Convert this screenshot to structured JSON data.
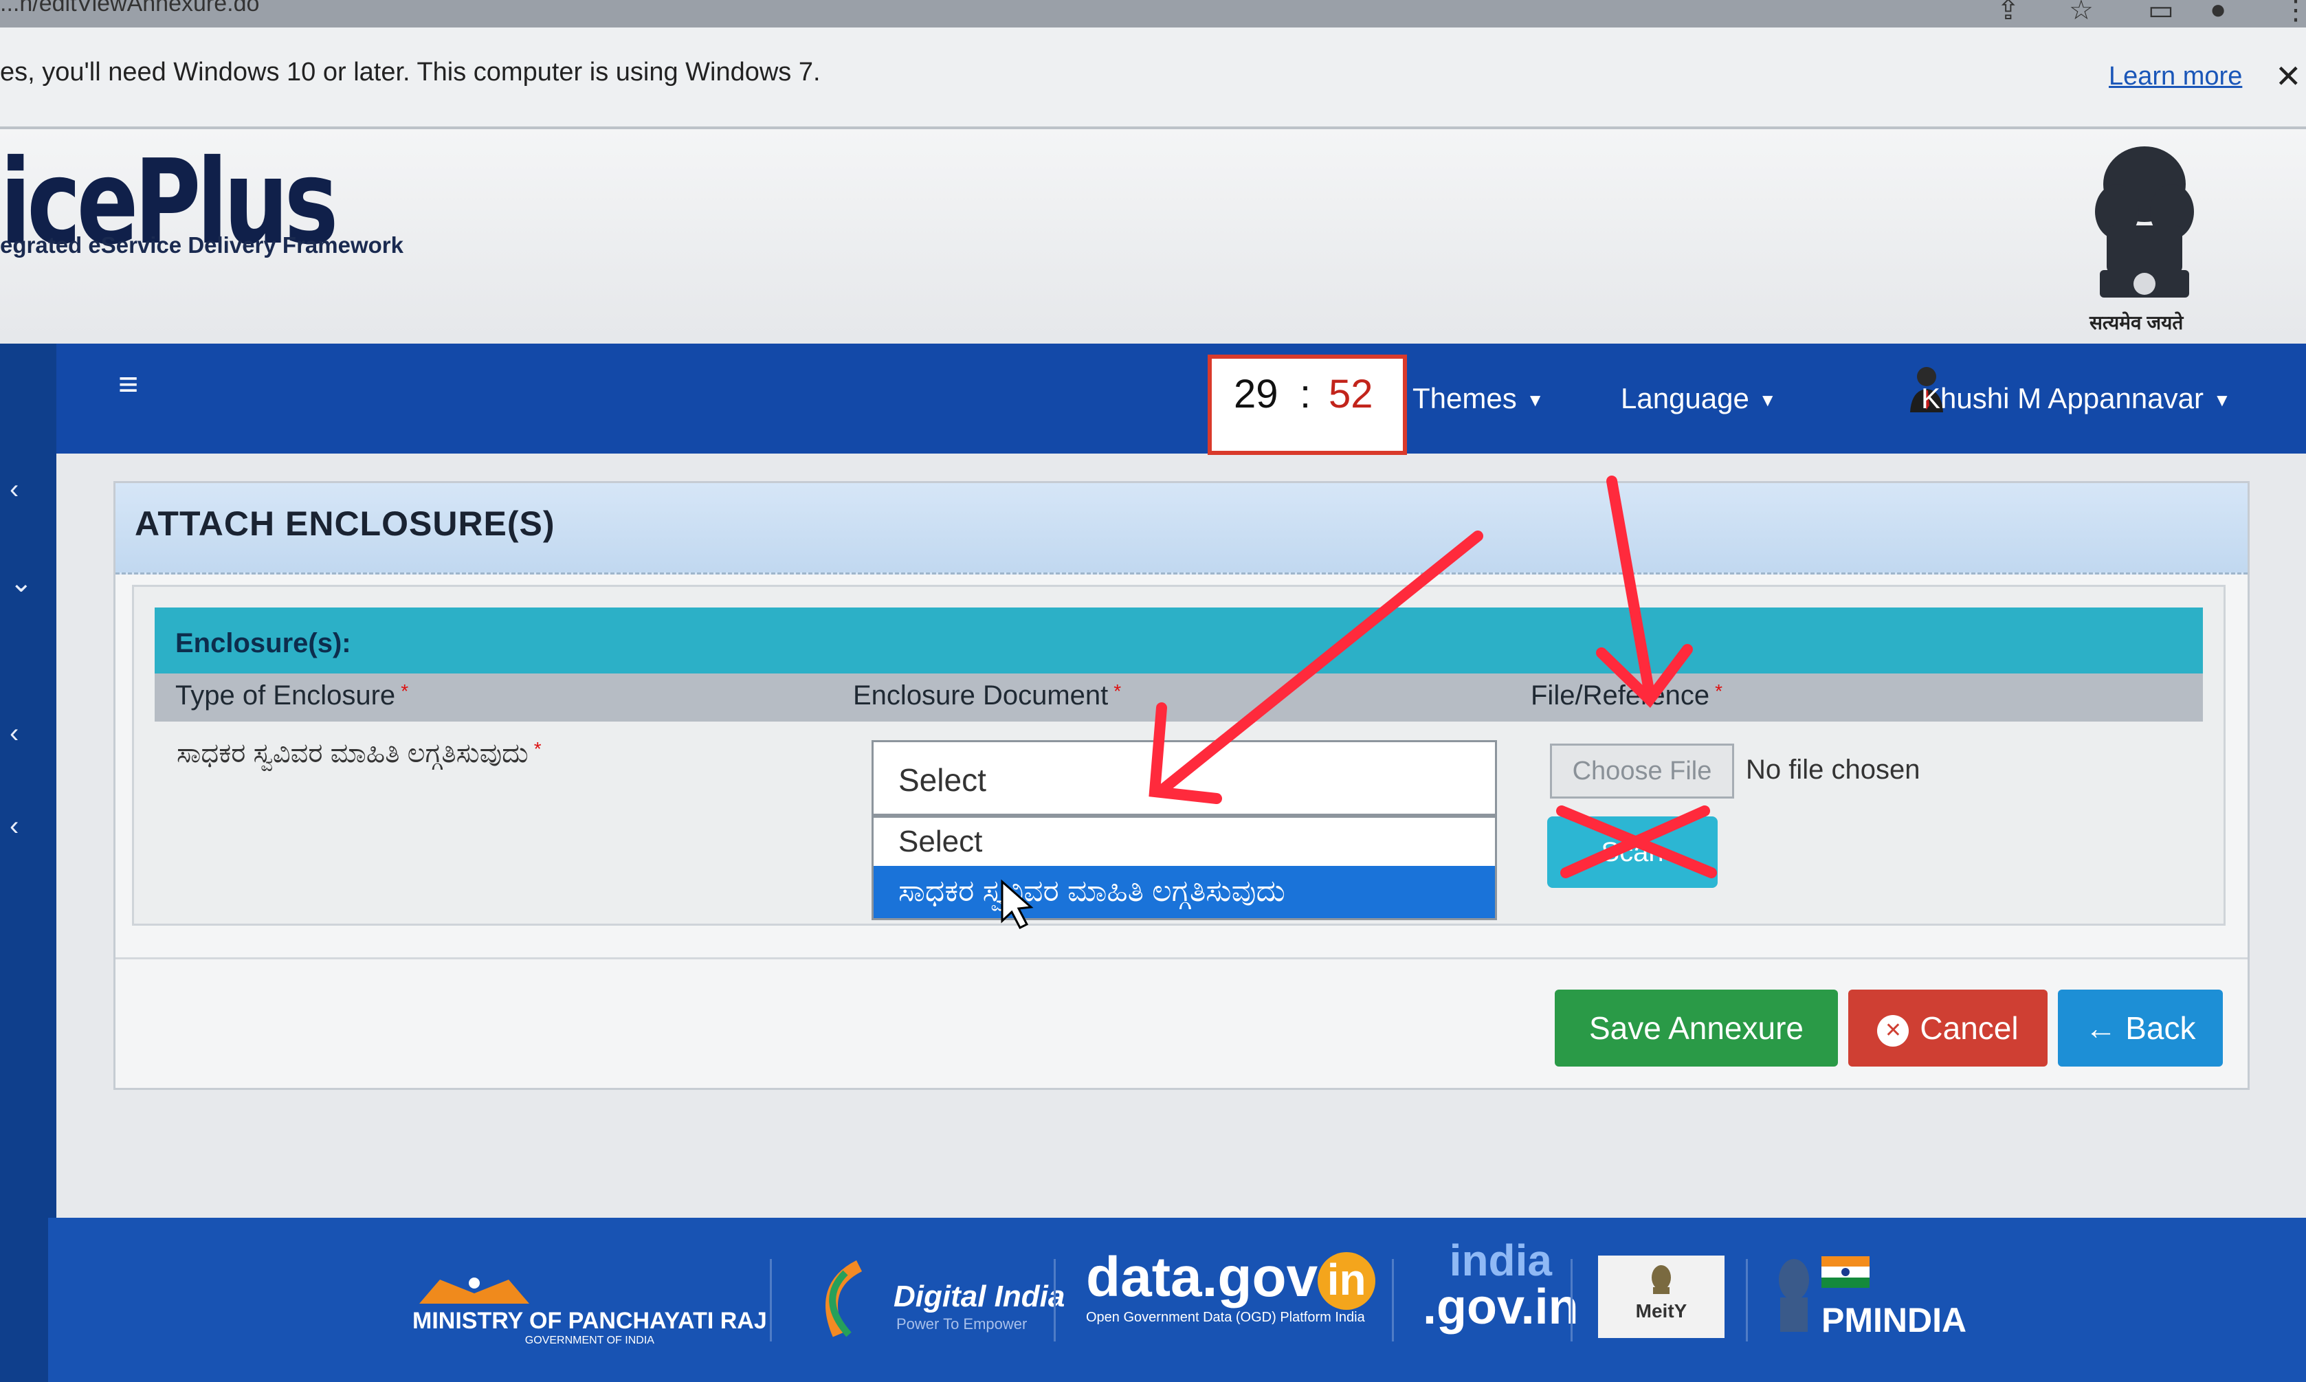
{
  "browser": {
    "url_fragment": "...n/editViewAnnexure.do"
  },
  "notice": {
    "message": "es, you'll need Windows 10 or later. This computer is using Windows 7.",
    "learn_more": "Learn more",
    "close_icon": "close-icon"
  },
  "header": {
    "logo_text": "icePlus",
    "logo_subtitle": "egrated eService Delivery Framework",
    "emblem_caption": "सत्यमेव जयते"
  },
  "navbar": {
    "timer_minutes": "29",
    "timer_separator": ":",
    "timer_seconds": "52",
    "themes_label": "Themes",
    "language_label": "Language",
    "user_name": "Khushi M Appannavar"
  },
  "panel": {
    "title": "ATTACH ENCLOSURE(S)",
    "section_label": "Enclosure(s):",
    "columns": {
      "type": "Type of Enclosure",
      "document": "Enclosure Document",
      "file": "File/Reference"
    },
    "required_mark": "*",
    "row_label": "ಸಾಧಕರ ಸ್ವವಿವರ ಮಾಹಿತಿ ಲಗ್ಗತಿಸುವುದು",
    "select_value": "Select",
    "dropdown_options": [
      "Select",
      "ಸಾಧಕರ ಸ್ವವಿವರ ಮಾಹಿತಿ ಲಗ್ಗತಿಸುವುದು"
    ],
    "choose_file": "Choose File",
    "no_file": "No file chosen",
    "scan_label": "Scan"
  },
  "buttons": {
    "save": "Save Annexure",
    "cancel": "Cancel",
    "back": "Back"
  },
  "footer": {
    "panchayati": "MINISTRY OF PANCHAYATI RAJ",
    "panchayati_sub": "GOVERNMENT OF INDIA",
    "digital_india": "Digital India",
    "digital_india_sub": "Power To Empower",
    "datagov": "data.gov",
    "datagov_in": "in",
    "datagov_sub": "Open Government Data (OGD) Platform India",
    "indiagov_top": "india",
    "indiagov_bottom": ".gov.in",
    "meity": "MeitY",
    "pmindia": "PMINDIA"
  },
  "colors": {
    "navbar": "#1349a8",
    "encl_bar": "#2cb0c7",
    "save": "#2a9a47",
    "cancel": "#cf3f33",
    "back": "#1d8fd6",
    "annotation": "#ff2a3c"
  }
}
